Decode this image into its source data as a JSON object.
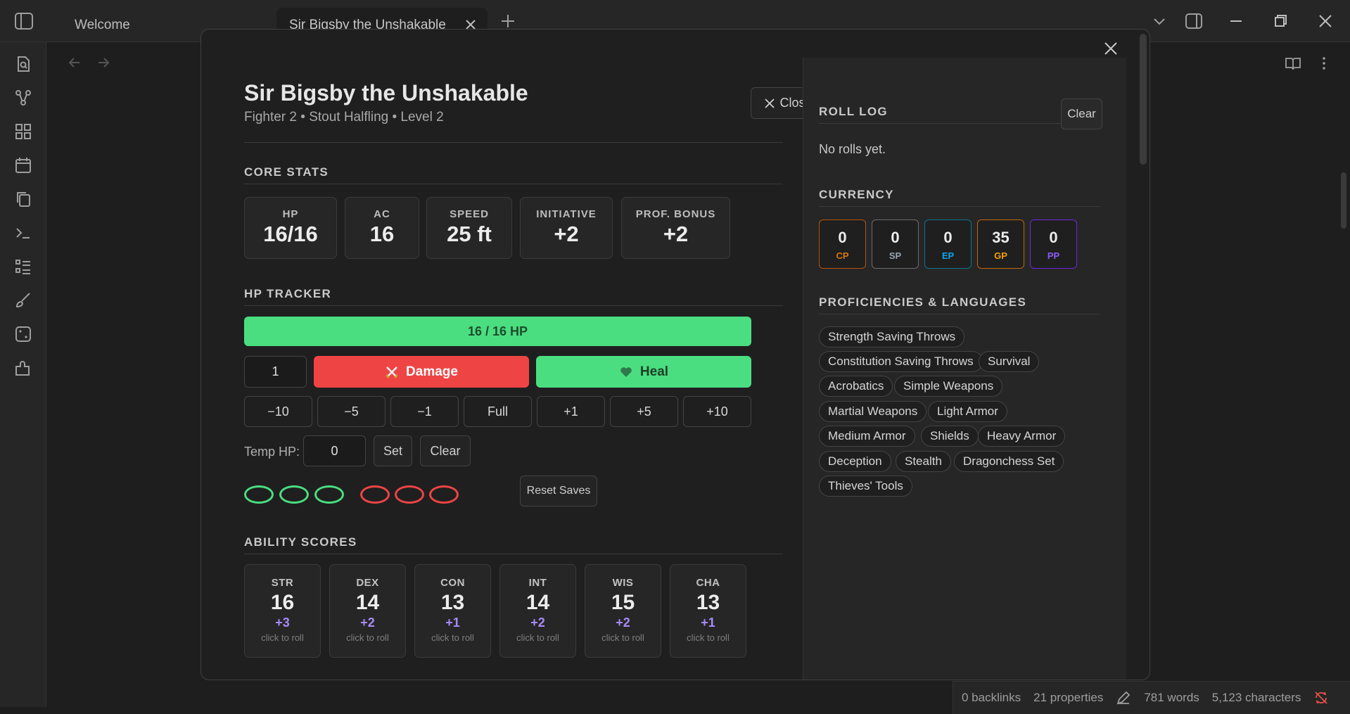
{
  "tabs": [
    {
      "label": "Welcome"
    },
    {
      "label": "Sir Bigsby the Unshakable"
    }
  ],
  "character": {
    "name": "Sir Bigsby the Unshakable",
    "subtitle": "Fighter 2 • Stout Halfling • Level 2",
    "close_label": "Close"
  },
  "core_stats": {
    "title": "CORE STATS",
    "items": [
      {
        "label": "HP",
        "value": "16/16"
      },
      {
        "label": "AC",
        "value": "16"
      },
      {
        "label": "SPEED",
        "value": "25 ft"
      },
      {
        "label": "INITIATIVE",
        "value": "+2"
      },
      {
        "label": "PROF. BONUS",
        "value": "+2"
      }
    ]
  },
  "hp_tracker": {
    "title": "HP TRACKER",
    "bar_text": "16 / 16 HP",
    "current": 16,
    "max": 16,
    "amount": "1",
    "damage_label": "Damage",
    "heal_label": "Heal",
    "quick_buttons": [
      "−10",
      "−5",
      "−1",
      "Full",
      "+1",
      "+5",
      "+10"
    ],
    "temp_label": "Temp HP:",
    "temp_value": "0",
    "set_label": "Set",
    "clear_label": "Clear",
    "death_save_successes": 0,
    "death_save_failures": 0,
    "reset_saves_label": "Reset Saves",
    "colors": {
      "success": "#4ade80",
      "failure": "#ef4444"
    }
  },
  "ability_scores": {
    "title": "ABILITY SCORES",
    "hint": "click to roll",
    "items": [
      {
        "label": "STR",
        "score": "16",
        "mod": "+3"
      },
      {
        "label": "DEX",
        "score": "14",
        "mod": "+2"
      },
      {
        "label": "CON",
        "score": "13",
        "mod": "+1"
      },
      {
        "label": "INT",
        "score": "14",
        "mod": "+2"
      },
      {
        "label": "WIS",
        "score": "15",
        "mod": "+2"
      },
      {
        "label": "CHA",
        "score": "13",
        "mod": "+1"
      }
    ]
  },
  "roll_log": {
    "title": "ROLL LOG",
    "clear_label": "Clear",
    "empty_text": "No rolls yet."
  },
  "currency": {
    "title": "CURRENCY",
    "coins": [
      {
        "label": "CP",
        "value": "0",
        "color": "#d97706"
      },
      {
        "label": "SP",
        "value": "0",
        "color": "#9ca3af"
      },
      {
        "label": "EP",
        "value": "0",
        "color": "#0ea5e9"
      },
      {
        "label": "GP",
        "value": "35",
        "color": "#f59e0b"
      },
      {
        "label": "PP",
        "value": "0",
        "color": "#8b5cf6"
      }
    ]
  },
  "proficiencies": {
    "title": "PROFICIENCIES & LANGUAGES",
    "items": [
      "Strength Saving Throws",
      "Constitution Saving Throws",
      "Survival",
      "Acrobatics",
      "Simple Weapons",
      "Martial Weapons",
      "Light Armor",
      "Medium Armor",
      "Shields",
      "Heavy Armor",
      "Deception",
      "Stealth",
      "Dragonchess Set",
      "Thieves' Tools"
    ]
  },
  "status_bar": {
    "backlinks": "0 backlinks",
    "properties": "21 properties",
    "words": "781 words",
    "characters": "5,123 characters"
  },
  "icons": {
    "ribbon": [
      "file-search-icon",
      "graph-icon",
      "layout-grid-icon",
      "calendar-icon",
      "copy-icon",
      "terminal-icon",
      "list-icon",
      "brush-icon",
      "dice-icon",
      "puzzle-icon"
    ]
  }
}
